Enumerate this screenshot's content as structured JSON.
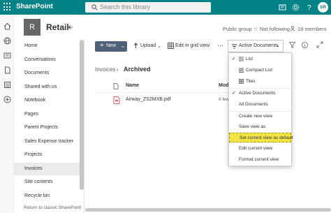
{
  "suitebar": {
    "app_name": "SharePoint",
    "search_placeholder": "Search this library",
    "avatar_initials": "SR"
  },
  "site": {
    "logo_letter": "R",
    "title": "Retail",
    "privacy": "Public group",
    "follow_label": "Not following",
    "members_label": "18 members"
  },
  "nav": {
    "items": [
      {
        "label": "Home"
      },
      {
        "label": "Conversations"
      },
      {
        "label": "Documents"
      },
      {
        "label": "Shared with us"
      },
      {
        "label": "Notebook"
      },
      {
        "label": "Pages"
      },
      {
        "label": "Parent Projects"
      },
      {
        "label": "Sales Expense tracker"
      },
      {
        "label": "Projects"
      },
      {
        "label": "Invoices"
      },
      {
        "label": "Site contents"
      },
      {
        "label": "Recycle bin"
      }
    ],
    "active": "Invoices",
    "return_link": "Return to classic SharePoint"
  },
  "commandbar": {
    "new_label": "New",
    "upload_label": "Upload",
    "grid_label": "Edit in grid view",
    "view_label": "Active Documents"
  },
  "breadcrumb": {
    "parent": "Invoices",
    "current": "Archived"
  },
  "list": {
    "columns": {
      "name": "Name",
      "modified": "Mod"
    },
    "rows": [
      {
        "name": "Airway_ZS2MXB.pdf",
        "modified": "A few"
      }
    ]
  },
  "view_menu": {
    "layouts": [
      "List",
      "Compact List",
      "Tiles"
    ],
    "views": [
      "Active Documents",
      "All Documents"
    ],
    "actions": [
      "Create new view",
      "Save view as",
      "Set current view as default",
      "Edit current view",
      "Format current view"
    ],
    "highlighted": "Set current view as default"
  },
  "colors": {
    "suitebar": "#038387",
    "new_button": "#4f6079",
    "highlight": "#f2e447"
  }
}
